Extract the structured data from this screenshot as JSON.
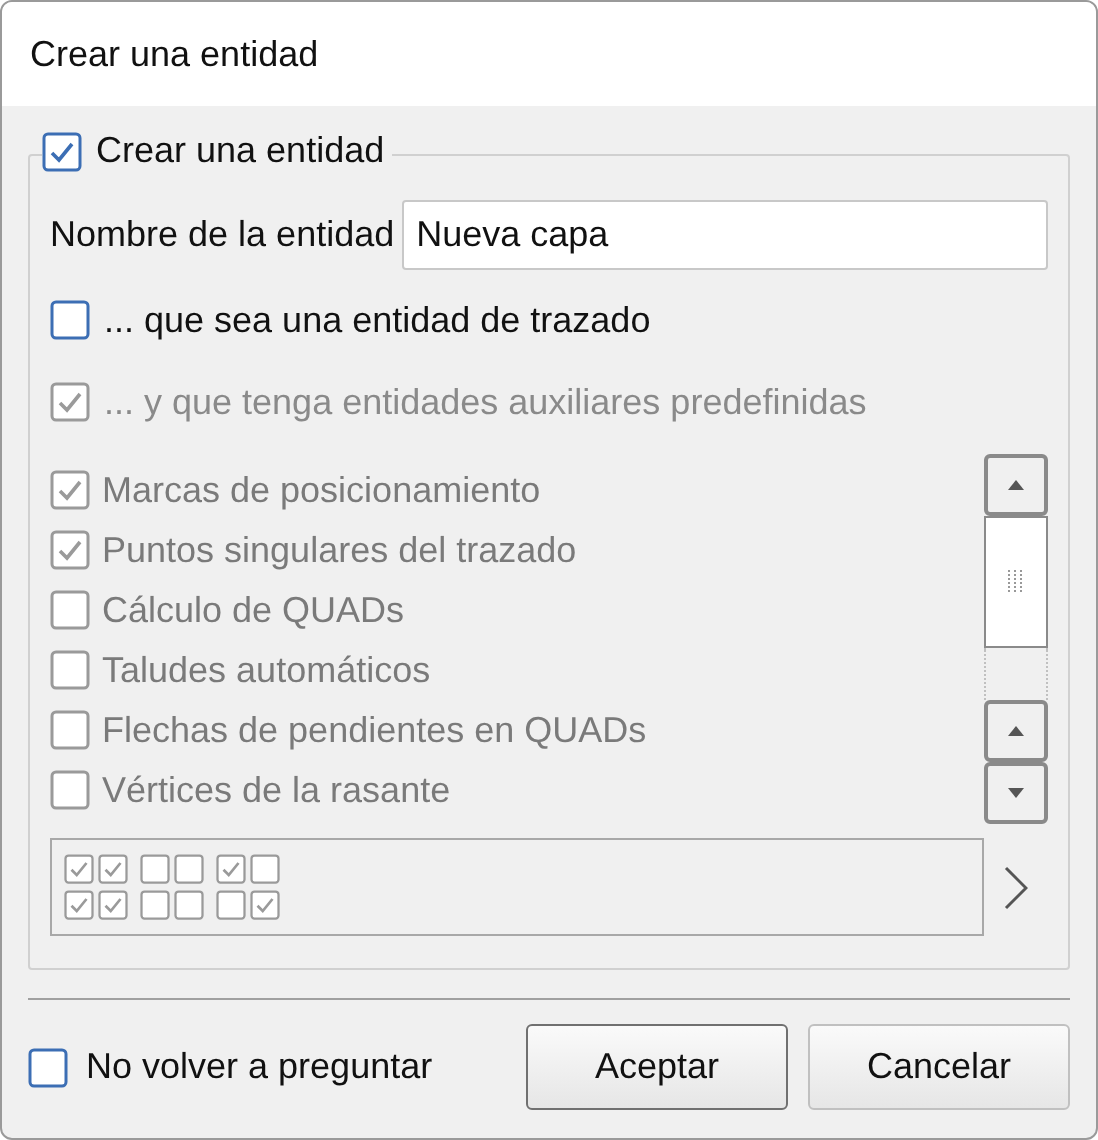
{
  "window": {
    "title": "Crear una entidad"
  },
  "group": {
    "label": "Crear una entidad",
    "checked": true
  },
  "name_field": {
    "label": "Nombre de la entidad",
    "value": "Nueva capa"
  },
  "options": [
    {
      "label": "... que sea una entidad de trazado",
      "checked": false,
      "disabled": false
    },
    {
      "label": "... y que tenga entidades auxiliares predefinidas",
      "checked": true,
      "disabled": true
    }
  ],
  "aux_list": [
    {
      "label": "Marcas de posicionamiento",
      "checked": true
    },
    {
      "label": "Puntos singulares del trazado",
      "checked": true
    },
    {
      "label": "Cálculo de QUADs",
      "checked": false
    },
    {
      "label": "Taludes automáticos",
      "checked": false
    },
    {
      "label": "Flechas de pendientes en QUADs",
      "checked": false
    },
    {
      "label": "Vértices de la rasante",
      "checked": false
    }
  ],
  "preview": [
    [
      {
        "checked": true
      },
      {
        "checked": true
      },
      {
        "checked": false
      },
      {
        "checked": false
      },
      {
        "checked": true
      },
      {
        "checked": false
      }
    ],
    [
      {
        "checked": true
      },
      {
        "checked": true
      },
      {
        "checked": false
      },
      {
        "checked": false
      },
      {
        "checked": false
      },
      {
        "checked": true
      }
    ]
  ],
  "footer": {
    "dont_ask": {
      "label": "No volver a preguntar",
      "checked": false
    },
    "buttons": [
      "Aceptar",
      "Cancelar"
    ]
  }
}
